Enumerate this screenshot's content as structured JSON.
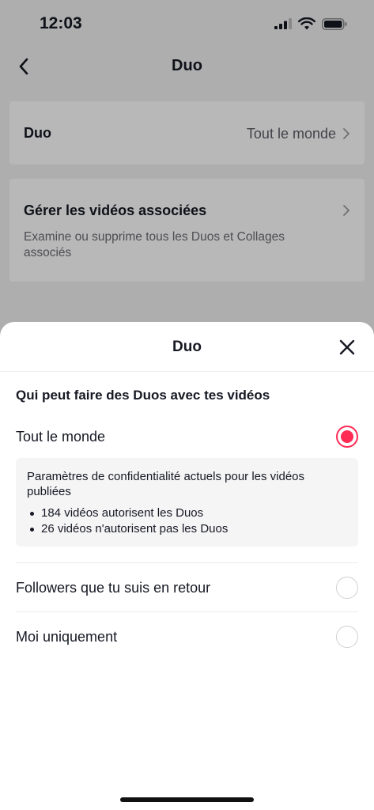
{
  "status": {
    "time": "12:03"
  },
  "nav": {
    "title": "Duo"
  },
  "settings": {
    "duo_label": "Duo",
    "duo_value": "Tout le monde",
    "manage_label": "Gérer les vidéos associées",
    "manage_desc": "Examine ou supprime tous les Duos et Collages associés"
  },
  "sheet": {
    "title": "Duo",
    "question": "Qui peut faire des Duos avec tes vidéos",
    "options": [
      {
        "label": "Tout le monde",
        "selected": true
      },
      {
        "label": "Followers que tu suis en retour",
        "selected": false
      },
      {
        "label": "Moi uniquement",
        "selected": false
      }
    ],
    "info": {
      "title": "Paramètres de confidentialité actuels pour les vidéos publiées",
      "items": [
        "184 vidéos autorisent les Duos",
        "26 vidéos n'autorisent pas les Duos"
      ]
    }
  },
  "colors": {
    "accent": "#fe2c55",
    "text": "#161823",
    "muted": "#6b6c73"
  },
  "icons": [
    "cellular-signal-icon",
    "wifi-icon",
    "battery-icon",
    "back-chevron-icon",
    "chevron-right-icon",
    "close-icon"
  ]
}
